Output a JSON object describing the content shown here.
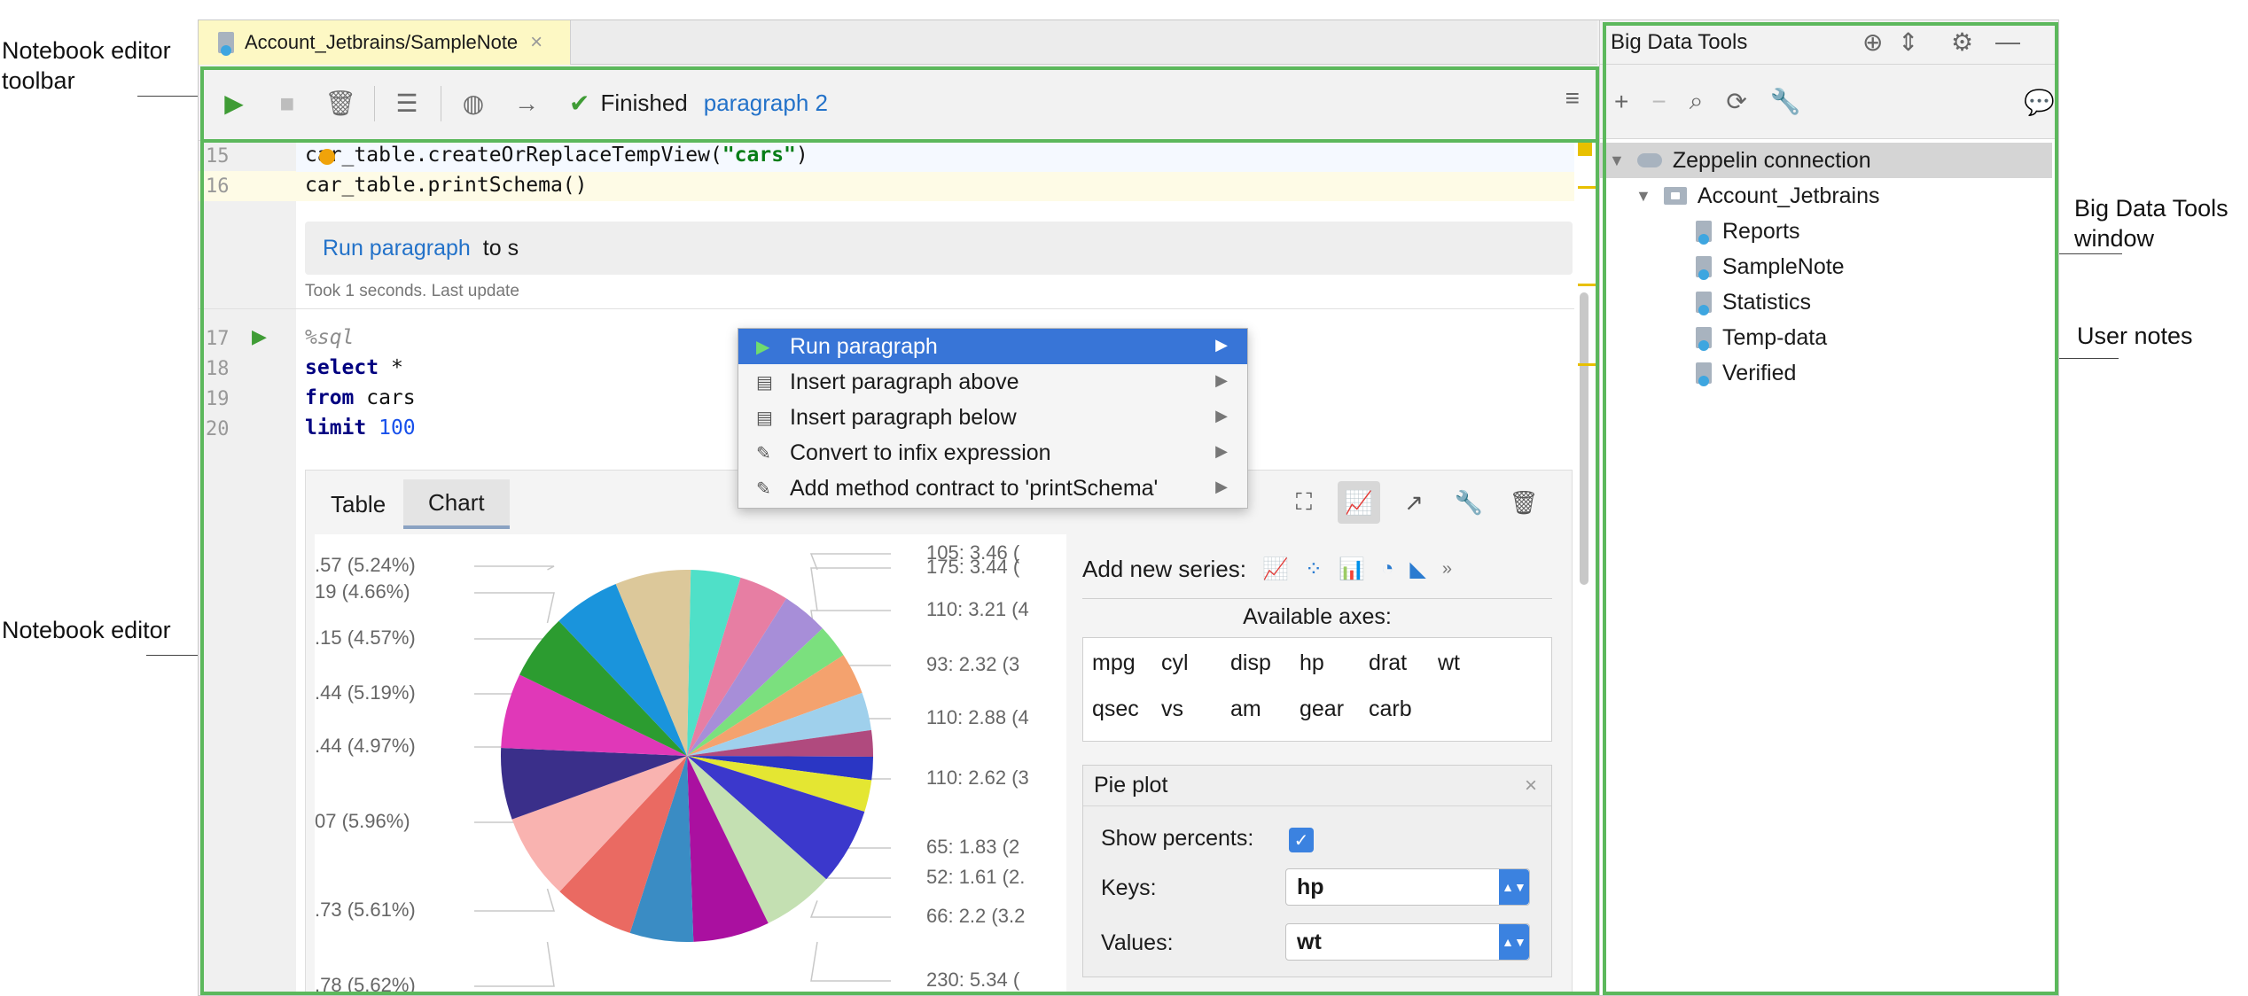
{
  "annotations": {
    "toolbar": [
      "Notebook editor",
      "toolbar"
    ],
    "editor": "Notebook editor",
    "bdt": [
      "Big Data Tools",
      "window"
    ],
    "user_notes": "User notes"
  },
  "editor_tab": {
    "title": "Account_Jetbrains/SampleNote"
  },
  "toolbar": {
    "status_text": "Finished",
    "status_link": "paragraph 2"
  },
  "code_lines": [
    {
      "num": "15",
      "text": "car_table.createOrReplaceTempView(",
      "str": "\"cars\"",
      "tail": ")"
    },
    {
      "num": "16",
      "text": "car_table.printSchema()"
    }
  ],
  "paragraph_box": {
    "link": "Run paragraph",
    "text": "to s"
  },
  "took_text": "Took 1 seconds. Last update",
  "sql_lines": [
    {
      "num": "17",
      "text": "%sql"
    },
    {
      "num": "18",
      "kw": "select",
      "text": " *"
    },
    {
      "num": "19",
      "kw": "from",
      "text": " cars"
    },
    {
      "num": "20",
      "kw": "limit",
      "text": " ",
      "numval": "100"
    }
  ],
  "context_menu": [
    {
      "label": "Run paragraph",
      "icon": "play-icon",
      "selected": true
    },
    {
      "label": "Insert paragraph above",
      "icon": "insert-above-icon"
    },
    {
      "label": "Insert paragraph below",
      "icon": "insert-below-icon"
    },
    {
      "label": "Convert to infix expression",
      "icon": "intention-icon"
    },
    {
      "label": "Add method contract to 'printSchema'",
      "icon": "intention-icon"
    }
  ],
  "result_tabs": [
    "Table",
    "Chart"
  ],
  "chart_panel": {
    "add_series_label": "Add new series:",
    "available_axes_label": "Available axes:",
    "axes": [
      "mpg",
      "cyl",
      "disp",
      "hp",
      "drat",
      "wt",
      "qsec",
      "vs",
      "am",
      "gear",
      "carb"
    ],
    "pie_plot": {
      "title": "Pie plot",
      "show_percents_label": "Show percents:",
      "show_percents": true,
      "keys_label": "Keys:",
      "keys_value": "hp",
      "values_label": "Values:",
      "values_value": "wt"
    }
  },
  "chart_data": {
    "type": "pie",
    "left_labels": [
      ".57 (5.24%)",
      "19 (4.66%)",
      ".15 (4.57%)",
      ".44 (5.19%)",
      ".44 (4.97%)",
      "07 (5.96%)",
      ".73 (5.61%)",
      ".78 (5.62%)"
    ],
    "right_labels": [
      "105: 3.46 (",
      "175: 3.44 (",
      "110: 3.21 (4",
      "93: 2.32 (3",
      "110: 2.88 (4",
      "110: 2.62 (3",
      "65: 1.83 (2",
      "52: 1.61 (2.",
      "66: 2.2 (3.2",
      "230: 5.34 ("
    ],
    "slices": [
      {
        "value": 3.46,
        "color": "#4fe0c8"
      },
      {
        "value": 3.44,
        "color": "#e77ea3"
      },
      {
        "value": 3.21,
        "color": "#a78ed8"
      },
      {
        "value": 2.32,
        "color": "#7be07e"
      },
      {
        "value": 2.88,
        "color": "#f4a26e"
      },
      {
        "value": 2.62,
        "color": "#9fd0ec"
      },
      {
        "value": 1.83,
        "color": "#b04a7e"
      },
      {
        "value": 1.61,
        "color": "#2a36c4"
      },
      {
        "value": 2.2,
        "color": "#e4e632"
      },
      {
        "value": 5.34,
        "color": "#3b38cc"
      },
      {
        "value": 5.0,
        "color": "#c4e0b2"
      },
      {
        "value": 5.3,
        "color": "#aa10a0"
      },
      {
        "value": 4.4,
        "color": "#3a8cc4"
      },
      {
        "value": 5.61,
        "color": "#ea6a62"
      },
      {
        "value": 5.96,
        "color": "#f9b3b0"
      },
      {
        "value": 4.97,
        "color": "#3a2f8a"
      },
      {
        "value": 5.19,
        "color": "#e038b8"
      },
      {
        "value": 4.57,
        "color": "#2c9c30"
      },
      {
        "value": 4.66,
        "color": "#1a94dc"
      },
      {
        "value": 5.24,
        "color": "#dcc89a"
      }
    ]
  },
  "bdt": {
    "title": "Big Data Tools",
    "tree": [
      {
        "label": "Zeppelin connection",
        "level": 0,
        "kind": "connection",
        "selected": true
      },
      {
        "label": "Account_Jetbrains",
        "level": 1,
        "kind": "folder"
      },
      {
        "label": "Reports",
        "level": 2,
        "kind": "note"
      },
      {
        "label": "SampleNote",
        "level": 2,
        "kind": "note"
      },
      {
        "label": "Statistics",
        "level": 2,
        "kind": "note"
      },
      {
        "label": "Temp-data",
        "level": 2,
        "kind": "note"
      },
      {
        "label": "Verified",
        "level": 2,
        "kind": "note"
      }
    ]
  }
}
